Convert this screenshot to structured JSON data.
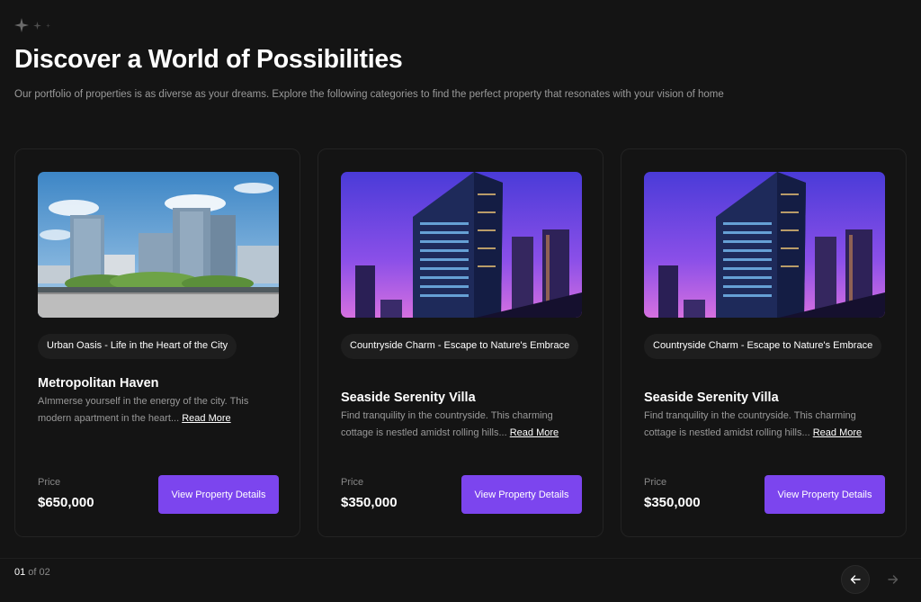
{
  "header": {
    "title": "Discover a World of Possibilities",
    "subtitle": "Our portfolio of properties is as diverse as your dreams. Explore the following categories to find the perfect property that resonates with your vision of home"
  },
  "cards": [
    {
      "tag": "Urban Oasis - Life in the Heart of the City",
      "title": "Metropolitan Haven",
      "description": "AImmerse yourself in the energy of the city. This modern apartment in the heart...",
      "read_more": "Read More",
      "price_label": "Price",
      "price": "$650,000",
      "button": "View Property Details"
    },
    {
      "tag": "Countryside Charm - Escape to Nature's Embrace",
      "title": "Seaside Serenity Villa",
      "description": "Find tranquility in the countryside. This charming cottage is nestled amidst rolling hills...",
      "read_more": "Read More",
      "price_label": "Price",
      "price": "$350,000",
      "button": "View Property Details"
    },
    {
      "tag": "Countryside Charm - Escape to Nature's Embrace",
      "title": "Seaside Serenity Villa",
      "description": "Find tranquility in the countryside. This charming cottage is nestled amidst rolling hills...",
      "read_more": "Read More",
      "price_label": "Price",
      "price": "$350,000",
      "button": "View Property Details"
    }
  ],
  "pagination": {
    "current": "01",
    "separator": " of ",
    "total": "02"
  },
  "icons": {
    "header": "sparkles-icon",
    "prev": "arrow-left-icon",
    "next": "arrow-right-icon"
  },
  "colors": {
    "background": "#141414",
    "accent": "#7c45ee",
    "text_muted": "#999999"
  }
}
